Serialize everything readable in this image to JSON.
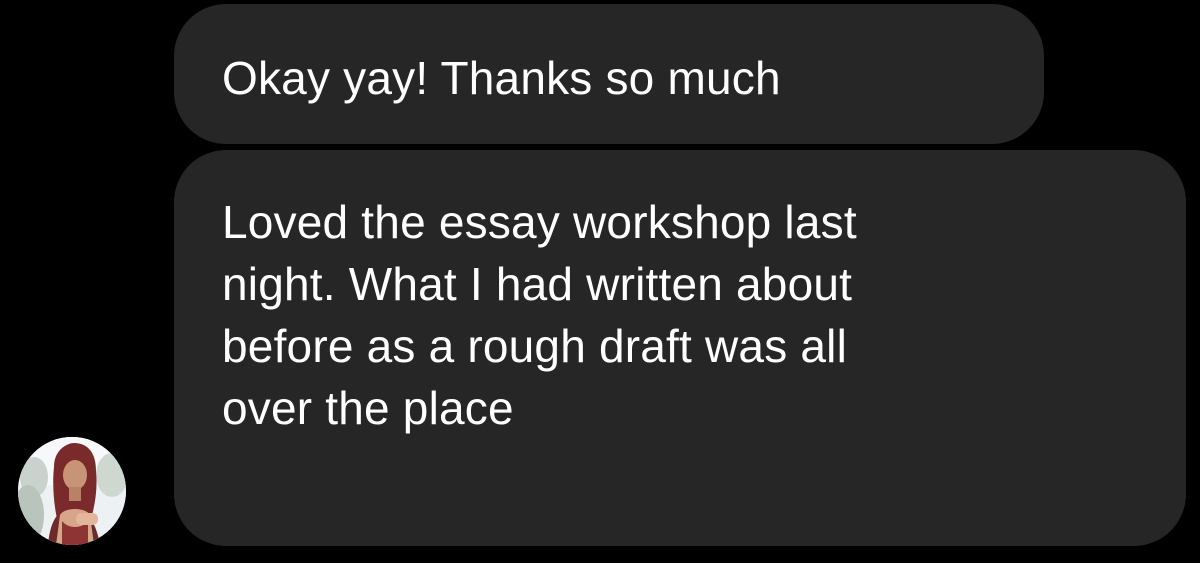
{
  "conversation": {
    "messages": [
      {
        "lines": [
          "Okay yay! Thanks so much"
        ]
      },
      {
        "lines": [
          "Loved the essay workshop last",
          "night. What I had written about",
          "before as a rough draft was all",
          "over the place"
        ]
      }
    ]
  },
  "colors": {
    "background": "#000000",
    "bubble": "#262626",
    "text": "#ffffff"
  },
  "icons": {
    "avatar": "sender-avatar-photo"
  }
}
